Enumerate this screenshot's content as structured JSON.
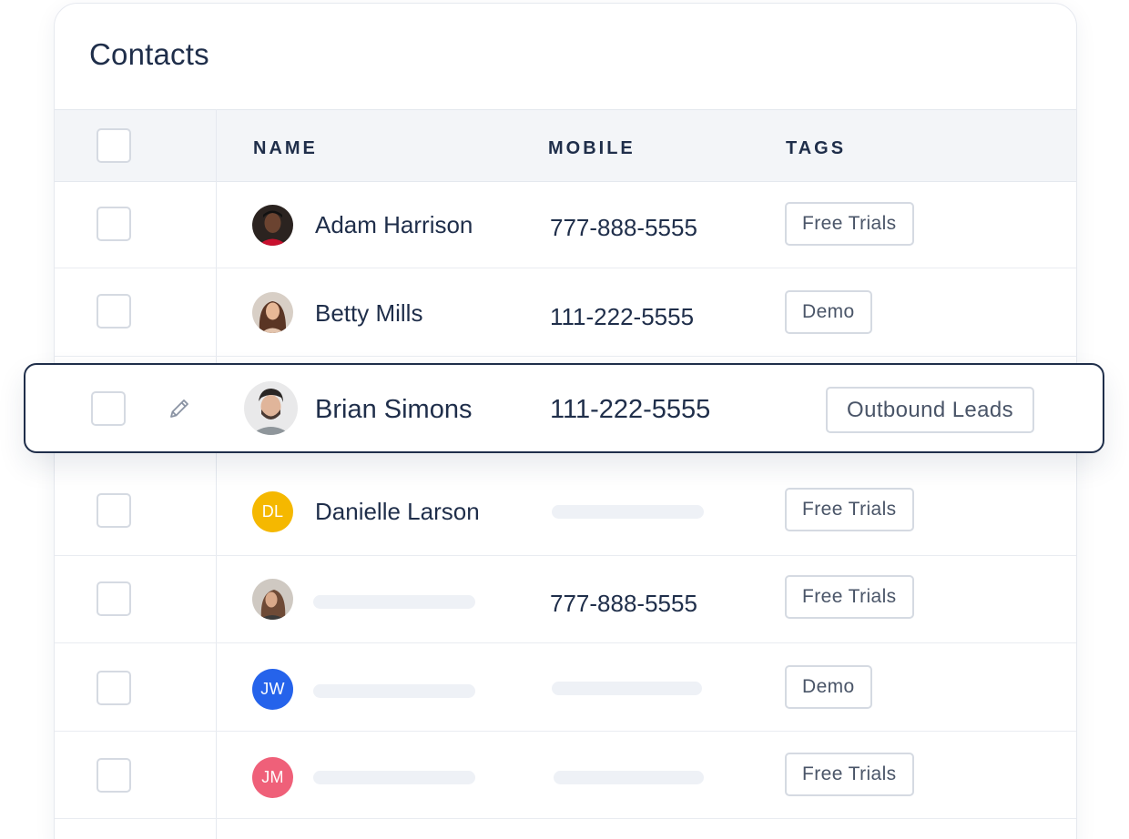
{
  "title": "Contacts",
  "columns": {
    "name": "NAME",
    "mobile": "MOBILE",
    "tags": "TAGS"
  },
  "rows": [
    {
      "name": "Adam Harrison",
      "mobile": "777-888-5555",
      "tag": "Free Trials",
      "avatar": "photo"
    },
    {
      "name": "Betty Mills",
      "mobile": "111-222-5555",
      "tag": "Demo",
      "avatar": "photo"
    },
    {
      "name": "Danielle Larson",
      "mobile": "",
      "tag": "Free Trials",
      "avatar": "initials",
      "initials": "DL",
      "avatar_color": "#f5b800"
    },
    {
      "name": "",
      "mobile": "777-888-5555",
      "tag": "Free Trials",
      "avatar": "photo"
    },
    {
      "name": "",
      "mobile": "",
      "tag": "Demo",
      "avatar": "initials",
      "initials": "JW",
      "avatar_color": "#2563eb"
    },
    {
      "name": "",
      "mobile": "",
      "tag": "Free Trials",
      "avatar": "initials",
      "initials": "JM",
      "avatar_color": "#ef6079"
    }
  ],
  "highlighted_row": {
    "name": "Brian Simons",
    "mobile": "111-222-5555",
    "tag": "Outbound Leads",
    "avatar": "photo",
    "edit_icon": "pencil-icon"
  },
  "colors": {
    "text_primary": "#1f2e4a",
    "border": "#d5dae2",
    "header_bg": "#f3f5f8",
    "placeholder": "#eef1f6"
  }
}
